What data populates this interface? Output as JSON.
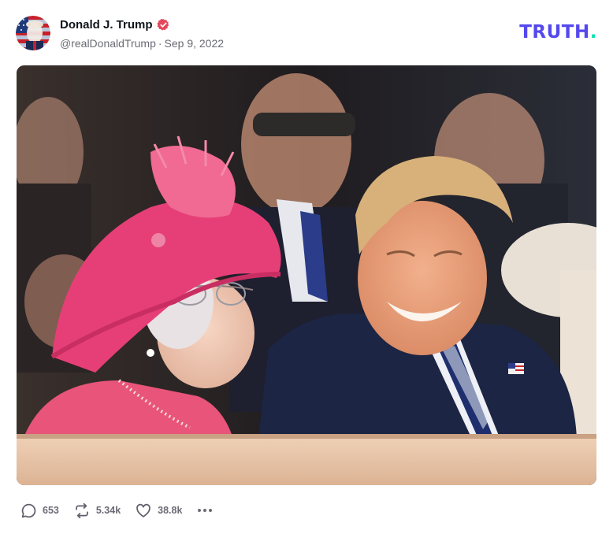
{
  "post": {
    "author": {
      "display_name": "Donald J. Trump",
      "verified": true,
      "handle": "@realDonaldTrump",
      "separator": "·",
      "date": "Sep 9, 2022",
      "avatar_icon": "avatar-portrait-flag"
    },
    "brand": {
      "text": "TRUTH",
      "dot": ".",
      "color": "#5448ee",
      "dot_color": "#0fe2b0"
    },
    "media": {
      "type": "photo",
      "alt": ""
    },
    "actions": {
      "reply": {
        "icon": "reply-icon",
        "count": "653"
      },
      "retruth": {
        "icon": "retruth-icon",
        "count": "5.34k"
      },
      "like": {
        "icon": "heart-icon",
        "count": "38.8k"
      },
      "more": {
        "icon": "more-icon"
      }
    },
    "colors": {
      "verified_badge": "#e3495b",
      "muted_text": "#6b6b76"
    }
  }
}
